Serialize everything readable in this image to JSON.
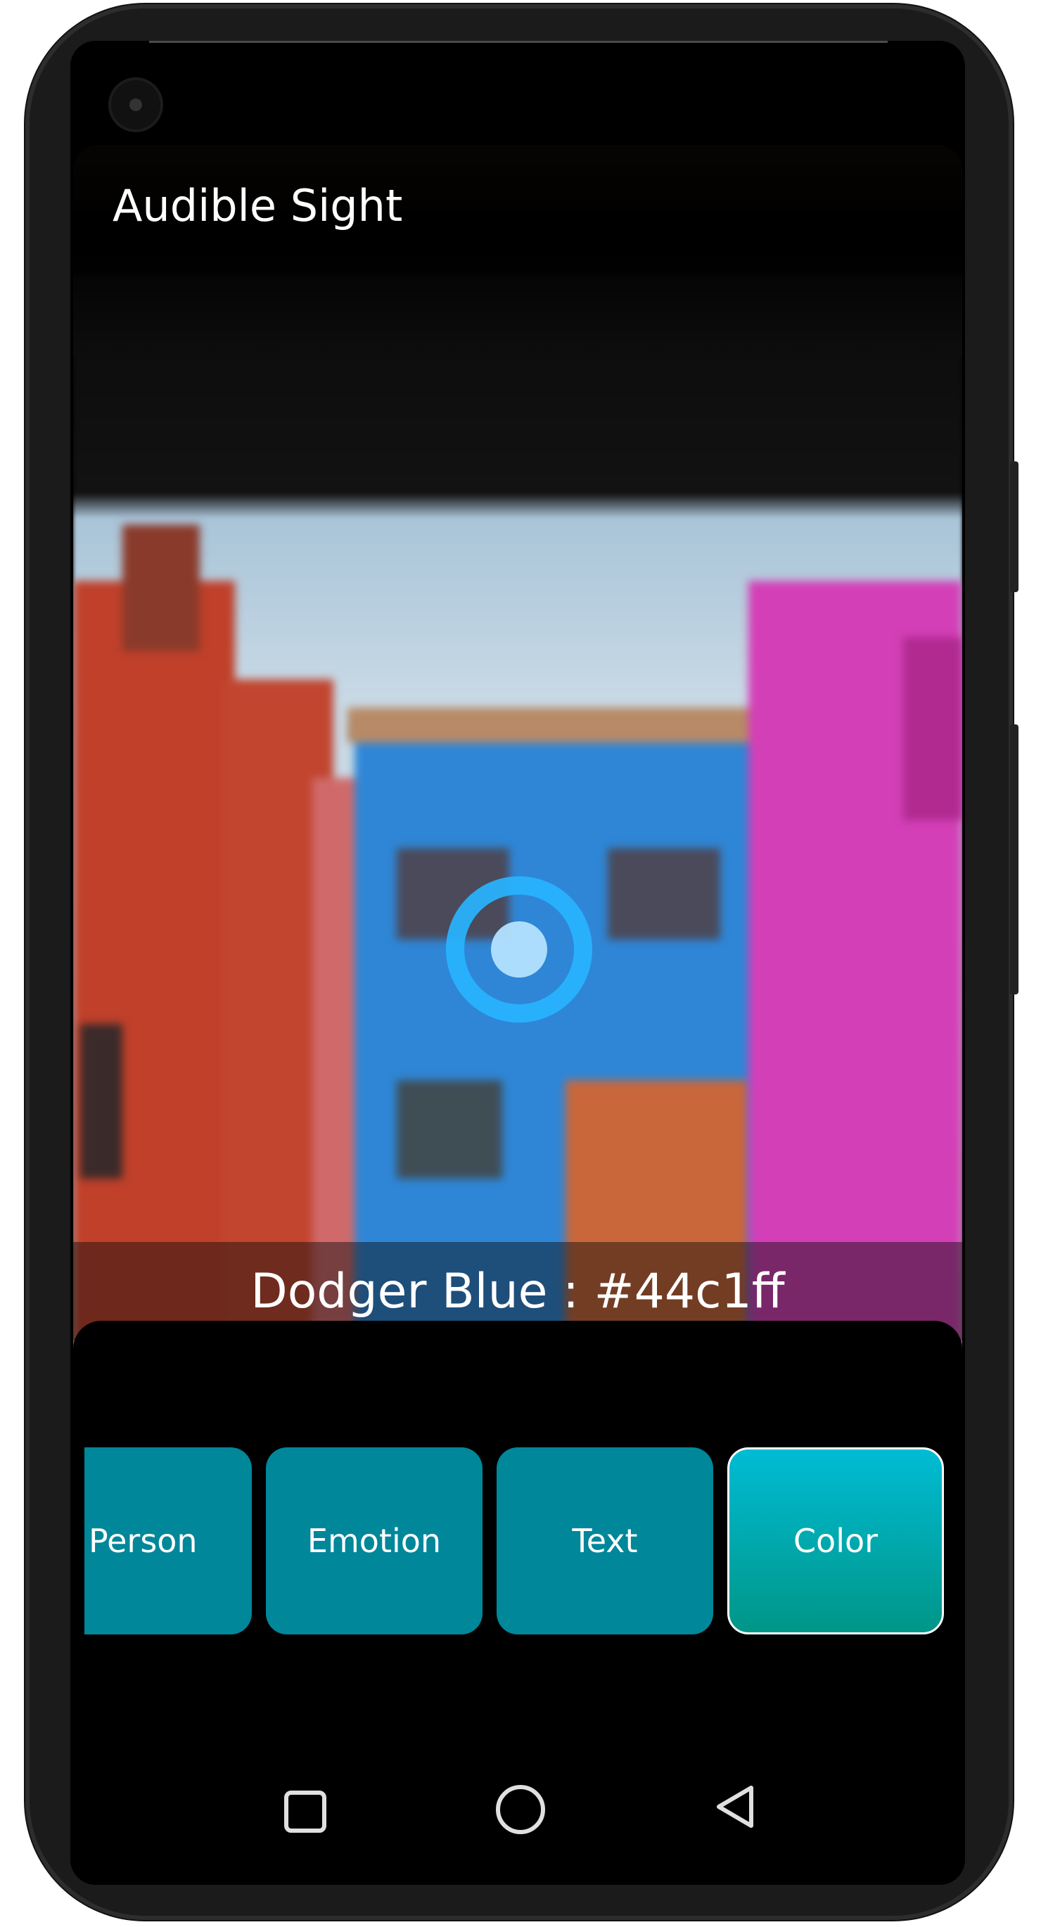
{
  "app": {
    "title": "Audible Sight"
  },
  "detection": {
    "result_text": "Dodger Blue : #44c1ff",
    "color_hex": "#44c1ff"
  },
  "modes": {
    "items": [
      {
        "label": "Person",
        "selected": false
      },
      {
        "label": "Emotion",
        "selected": false
      },
      {
        "label": "Text",
        "selected": false
      },
      {
        "label": "Color",
        "selected": true
      }
    ]
  },
  "theme": {
    "button_color": "#00879a",
    "selected_gradient_top": "#00bcd4",
    "selected_gradient_bottom": "#009688",
    "target_color": "#28b4ff"
  },
  "nav": {
    "icons": [
      "recents-square-icon",
      "home-circle-icon",
      "back-triangle-icon"
    ]
  }
}
